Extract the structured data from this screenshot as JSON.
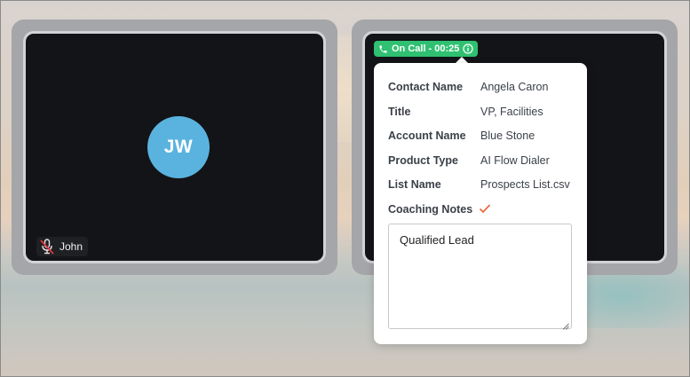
{
  "participant": {
    "initials": "JW",
    "name": "John",
    "avatar_color": "#5ab3df",
    "mic_icon": "mic-muted-icon"
  },
  "call_status": {
    "label": "On Call - 00:25",
    "color": "#2fc171",
    "phone_icon": "phone-icon",
    "info_icon": "info-icon"
  },
  "details": {
    "contact_name_label": "Contact Name",
    "contact_name": "Angela Caron",
    "title_label": "Title",
    "title": "VP, Facilities",
    "account_name_label": "Account Name",
    "account_name": "Blue Stone",
    "product_type_label": "Product Type",
    "product_type": "AI Flow Dialer",
    "list_name_label": "List Name",
    "list_name": "Prospects List.csv",
    "coaching_notes_label": "Coaching Notes",
    "coaching_notes": "Qualified Lead",
    "check_color": "#ea6a45"
  }
}
